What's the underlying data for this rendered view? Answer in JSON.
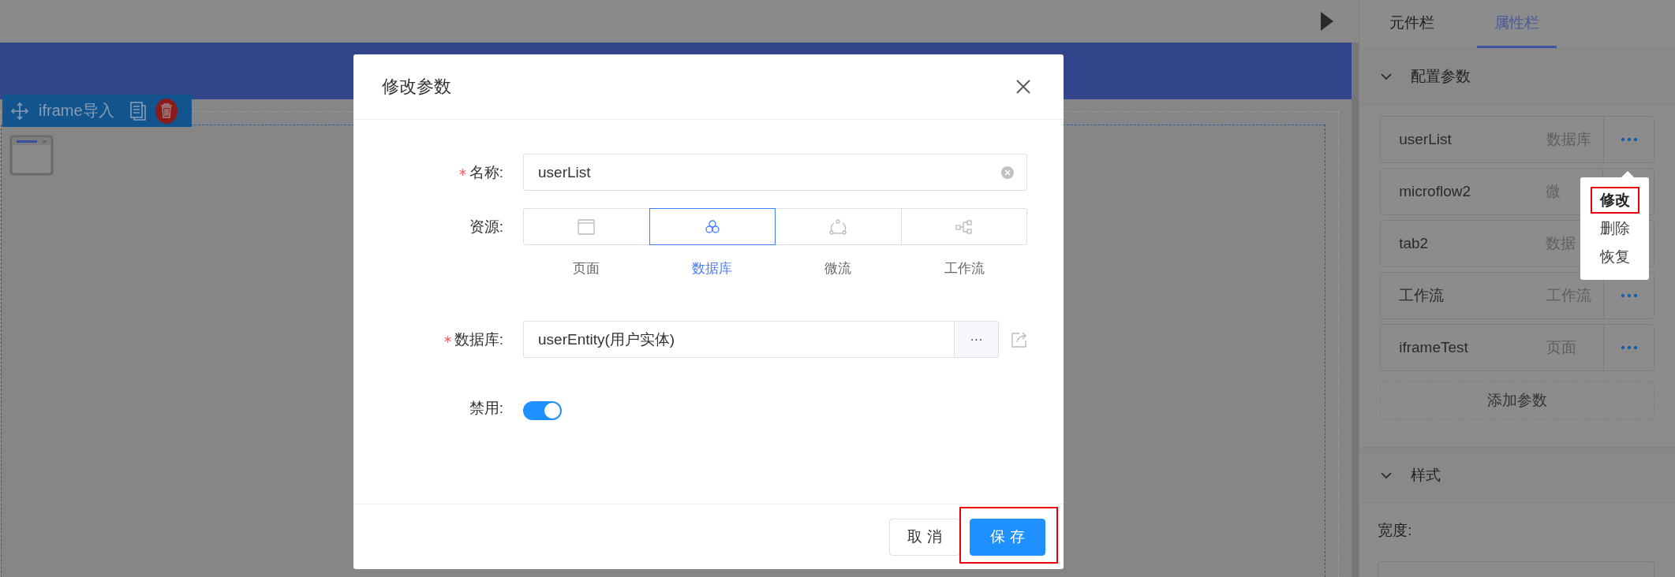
{
  "canvas": {
    "component_label": "iframe导入"
  },
  "right_panel": {
    "tabs": [
      {
        "label": "元件栏",
        "selected": false
      },
      {
        "label": "属性栏",
        "selected": true
      }
    ],
    "sections": [
      {
        "title": "配置参数",
        "expanded": true
      },
      {
        "title": "样式",
        "expanded": true
      }
    ],
    "params": [
      {
        "name": "userList",
        "type": "数据库",
        "actions_visible": true
      },
      {
        "name": "microflow2",
        "type": "微",
        "actions_visible": false
      },
      {
        "name": "tab2",
        "type": "数据",
        "actions_visible": false
      },
      {
        "name": "工作流",
        "type": "工作流",
        "actions_visible": true
      },
      {
        "name": "iframeTest",
        "type": "页面",
        "actions_visible": true
      }
    ],
    "add_button": "添加参数",
    "width_label": "宽度:",
    "menu": [
      {
        "label": "修改",
        "highlighted": true
      },
      {
        "label": "删除",
        "highlighted": false
      },
      {
        "label": "恢复",
        "highlighted": false
      }
    ]
  },
  "dialog": {
    "title": "修改参数",
    "name": {
      "label": "名称:",
      "required": true,
      "value": "userList"
    },
    "source": {
      "label": "资源:",
      "options": [
        {
          "kind": "page",
          "label": "页面",
          "selected": false
        },
        {
          "kind": "database",
          "label": "数据库",
          "selected": true
        },
        {
          "kind": "microflow",
          "label": "微流",
          "selected": false
        },
        {
          "kind": "workflow",
          "label": "工作流",
          "selected": false
        }
      ]
    },
    "database": {
      "label": "数据库:",
      "required": true,
      "value": "userEntity(用户实体)",
      "browse": "···"
    },
    "disabled": {
      "label": "禁用:",
      "on": true
    },
    "buttons": [
      {
        "kind": "cancel",
        "label": "取消",
        "highlighted": false
      },
      {
        "kind": "save",
        "label": "保存",
        "highlighted": true
      }
    ]
  }
}
